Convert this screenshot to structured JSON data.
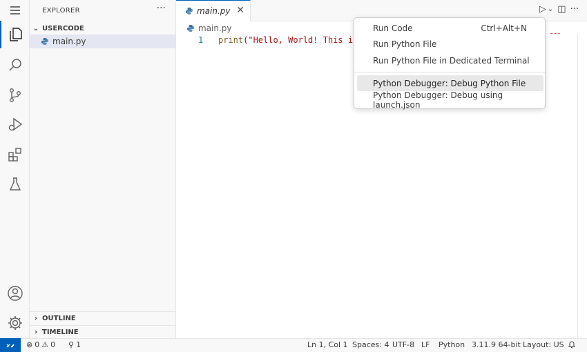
{
  "sidebar": {
    "title": "EXPLORER",
    "more": "···",
    "folder": "USERCODE",
    "file": "main.py",
    "outline": "OUTLINE",
    "timeline": "TIMELINE"
  },
  "editor": {
    "tab_label": "main.py",
    "tab_close": "✕",
    "breadcrumb": "main.py",
    "line_number": "1",
    "code_fn": "print",
    "code_open": "(",
    "code_string": "\"Hello, World! This is",
    "actions": {
      "run": "▷",
      "run_dropdown": "⌄",
      "split": "◫",
      "more": "···"
    }
  },
  "menu": {
    "items": [
      {
        "label": "Run Code",
        "shortcut": "Ctrl+Alt+N"
      },
      {
        "label": "Run Python File",
        "shortcut": ""
      },
      {
        "label": "Run Python File in Dedicated Terminal",
        "shortcut": ""
      },
      {
        "label": "Python Debugger: Debug Python File",
        "shortcut": ""
      },
      {
        "label": "Python Debugger: Debug using launch.json",
        "shortcut": ""
      }
    ],
    "highlighted_index": 3
  },
  "status": {
    "errors": "0",
    "warnings": "0",
    "ports": "1",
    "position": "Ln 1, Col 1",
    "spaces": "Spaces: 4",
    "encoding": "UTF-8",
    "eol": "LF",
    "language": "Python",
    "interpreter": "3.11.9 64-bit",
    "layout": "Layout: US"
  },
  "colors": {
    "accent": "#005fb8",
    "string": "#a31515",
    "function": "#795e26",
    "line_number": "#237893"
  },
  "icons": {
    "activity": [
      "menu-icon",
      "explorer-icon",
      "search-icon",
      "source-control-icon",
      "run-debug-icon",
      "extensions-icon",
      "testing-icon",
      "account-icon",
      "settings-gear-icon"
    ]
  }
}
